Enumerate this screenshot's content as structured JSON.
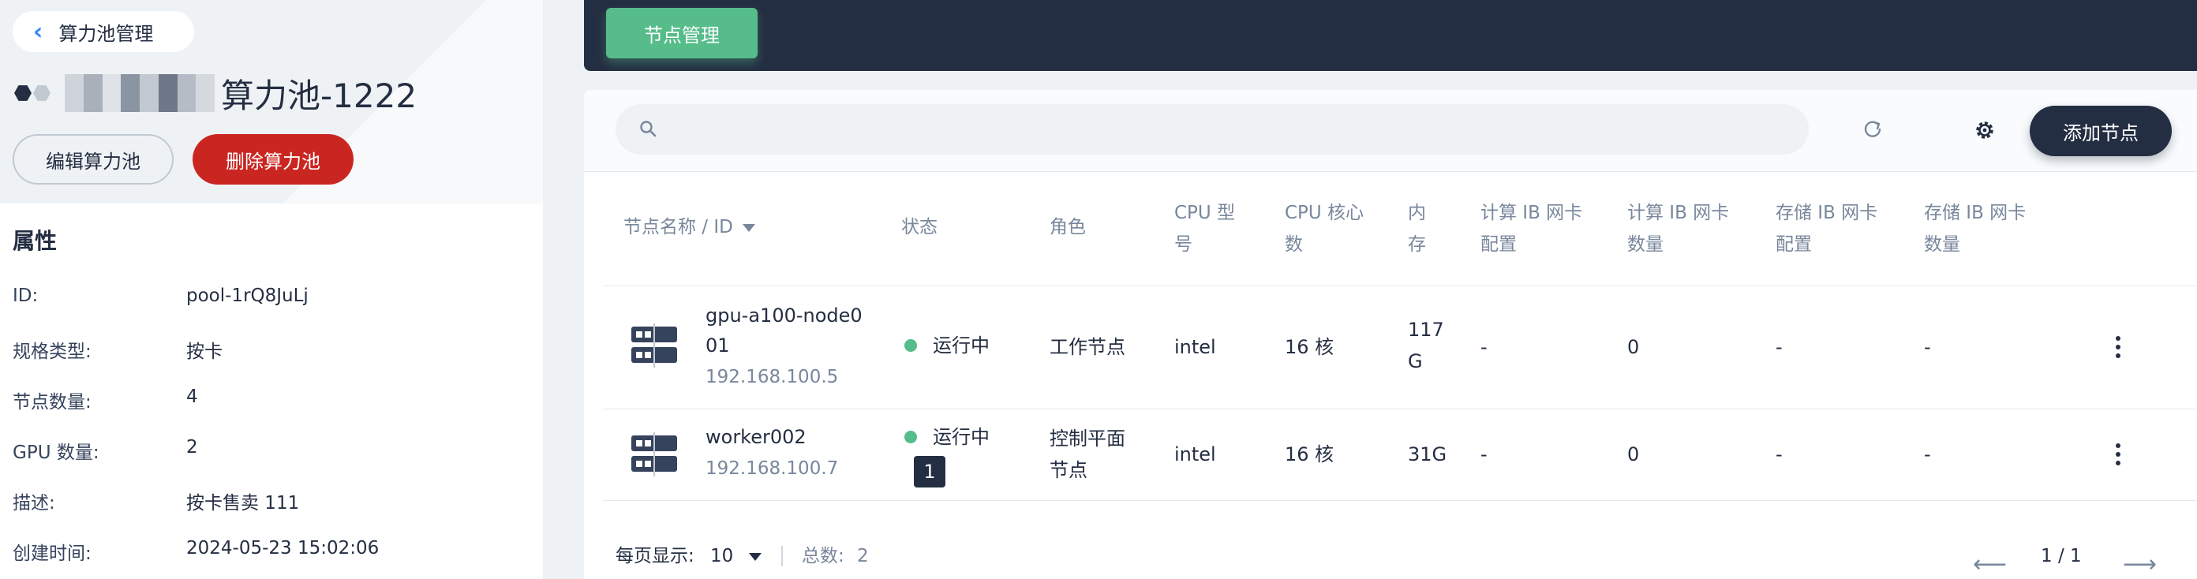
{
  "back": {
    "label": "算力池管理"
  },
  "pool": {
    "name_suffix": "算力池-1222"
  },
  "actions": {
    "edit": "编辑算力池",
    "delete": "删除算力池"
  },
  "props": {
    "title": "属性",
    "rows": [
      {
        "k": "ID:",
        "v": "pool-1rQ8JuLj"
      },
      {
        "k": "规格类型:",
        "v": "按卡"
      },
      {
        "k": "节点数量:",
        "v": "4"
      },
      {
        "k": "GPU 数量:",
        "v": "2"
      },
      {
        "k": "描述:",
        "v": "按卡售卖  111"
      },
      {
        "k": "创建时间:",
        "v": "2024-05-23 15:02:06"
      }
    ]
  },
  "tab": {
    "label": "节点管理"
  },
  "toolbar": {
    "add_label": "添加节点",
    "search_placeholder": ""
  },
  "table": {
    "headers": {
      "name": "节点名称 / ID",
      "status": "状态",
      "role": "角色",
      "cpu_model_1": "CPU 型",
      "cpu_model_2": "号",
      "cpu_cores_1": "CPU 核心",
      "cpu_cores_2": "数",
      "mem_1": "内",
      "mem_2": "存",
      "cib_cfg_1": "计算 IB 网卡",
      "cib_cfg_2": "配置",
      "cib_cnt_1": "计算 IB 网卡",
      "cib_cnt_2": "数量",
      "sib_cfg_1": "存储 IB 网卡",
      "sib_cfg_2": "配置",
      "sib_cnt_1": "存储 IB 网卡",
      "sib_cnt_2": "数量"
    },
    "rows": [
      {
        "name_1": "gpu-a100-node0",
        "name_2": "01",
        "ip": "192.168.100.5",
        "status": "运行中",
        "role_1": "工作节点",
        "role_2": "",
        "cpu": "intel",
        "cores": "16 核",
        "mem_1": "117",
        "mem_2": "G",
        "cib_cfg": "-",
        "cib_cnt": "0",
        "sib_cfg": "-",
        "sib_cnt": "-"
      },
      {
        "name_1": "worker002",
        "name_2": "",
        "ip": "192.168.100.7",
        "status": "运行中",
        "role_1": "控制平面",
        "role_2": "节点",
        "cpu": "intel",
        "cores": "16 核",
        "mem_1": "31G",
        "mem_2": "",
        "cib_cfg": "-",
        "cib_cnt": "0",
        "sib_cfg": "-",
        "sib_cnt": "-"
      }
    ],
    "tooltip": "1"
  },
  "footer": {
    "per_page_label": "每页显示:",
    "per_page_value": "10",
    "total_label": "总数:",
    "total_value": "2",
    "page": "1 / 1"
  },
  "colors": {
    "header_bg": "#242e42",
    "accent_green": "#55bc8a",
    "danger": "#ca2621",
    "text_muted": "#79879c"
  }
}
